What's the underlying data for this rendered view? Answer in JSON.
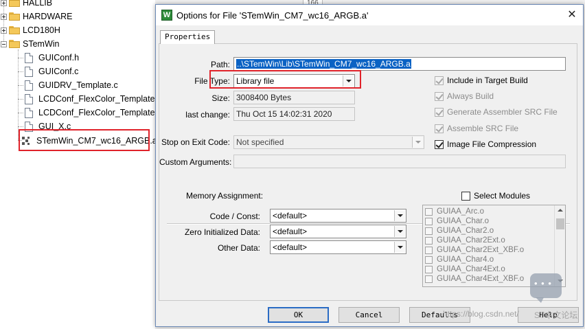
{
  "tree": {
    "items": [
      {
        "label": "HALLIB",
        "kind": "folder",
        "expander": "plus"
      },
      {
        "label": "HARDWARE",
        "kind": "folder",
        "expander": "plus"
      },
      {
        "label": "LCD180H",
        "kind": "folder",
        "expander": "plus"
      },
      {
        "label": "STemWin",
        "kind": "folder",
        "expander": "minus"
      },
      {
        "label": "GUIConf.h",
        "kind": "file"
      },
      {
        "label": "GUIConf.c",
        "kind": "file"
      },
      {
        "label": "GUIDRV_Template.c",
        "kind": "file"
      },
      {
        "label": "LCDConf_FlexColor_Template.h",
        "kind": "file"
      },
      {
        "label": "LCDConf_FlexColor_Template.c",
        "kind": "file"
      },
      {
        "label": "GUI_X.c",
        "kind": "file"
      },
      {
        "label": "STemWin_CM7_wc16_ARGB.a",
        "kind": "library",
        "selected": true
      }
    ]
  },
  "background": {
    "line_number": "166"
  },
  "dialog": {
    "title": "Options for File 'STemWin_CM7_wc16_ARGB.a'",
    "close": "✕",
    "app_icon": "W",
    "tab": "Properties",
    "path": {
      "label": "Path:",
      "value": "..\\STemWin\\Lib\\STemWin_CM7_wc16_ARGB.a"
    },
    "file_type": {
      "label": "File Type:",
      "value": "Library file"
    },
    "size": {
      "label": "Size:",
      "value": "3008400 Bytes"
    },
    "last_change": {
      "label": "last change:",
      "value": "Thu Oct 15 14:02:31 2020"
    },
    "stop_on_exit": {
      "label": "Stop on Exit Code:",
      "value": "Not specified"
    },
    "custom_args": {
      "label": "Custom Arguments:",
      "value": ""
    },
    "checks": [
      {
        "label": "Include in Target Build",
        "checked": true,
        "enabled": true
      },
      {
        "label": "Always Build",
        "checked": true,
        "enabled": false
      },
      {
        "label": "Generate Assembler SRC File",
        "checked": true,
        "enabled": false
      },
      {
        "label": "Assemble SRC File",
        "checked": true,
        "enabled": false
      },
      {
        "label": "Image File Compression",
        "checked": true,
        "enabled": true
      }
    ],
    "memory": {
      "heading": "Memory Assignment:",
      "code_const": {
        "label": "Code / Const:",
        "value": "<default>"
      },
      "zero_init": {
        "label": "Zero Initialized Data:",
        "value": "<default>"
      },
      "other": {
        "label": "Other Data:",
        "value": "<default>"
      }
    },
    "select_modules": {
      "label": "Select Modules",
      "checked": false
    },
    "modules": [
      "GUIAA_Arc.o",
      "GUIAA_Char.o",
      "GUIAA_Char2.o",
      "GUIAA_Char2Ext.o",
      "GUIAA_Char2Ext_XBF.o",
      "GUIAA_Char4.o",
      "GUIAA_Char4Ext.o",
      "GUIAA_Char4Ext_XBF.o"
    ],
    "buttons": {
      "ok": "OK",
      "cancel": "Cancel",
      "defaults": "Defaults",
      "help": "Help"
    }
  },
  "watermark": {
    "text": "https://blog.csdn.net/",
    "text2": "ST中文论坛"
  },
  "colors": {
    "highlight": "#0a62c4",
    "annotation_red": "#e0222a"
  }
}
